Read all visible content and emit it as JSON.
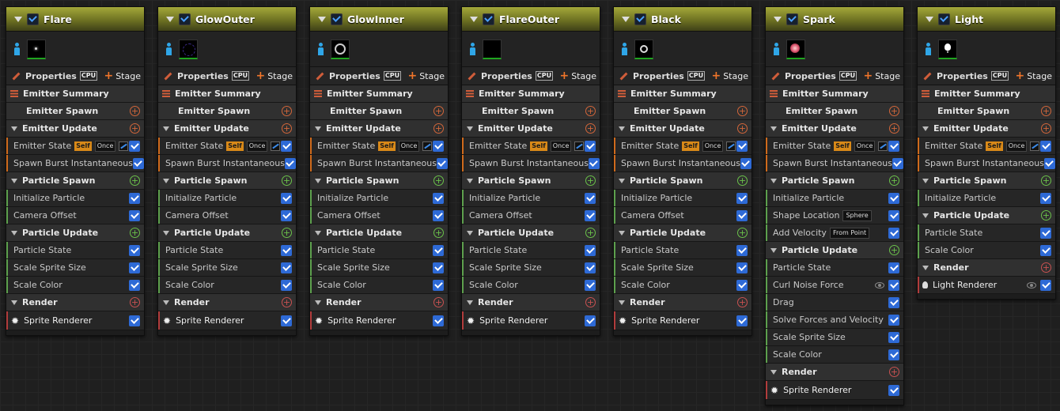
{
  "common": {
    "properties": "Properties",
    "cpu": "CPU",
    "stage": "Stage",
    "emitter_summary": "Emitter Summary",
    "emitter_spawn": "Emitter Spawn",
    "emitter_update": "Emitter Update",
    "particle_spawn": "Particle Spawn",
    "particle_update": "Particle Update",
    "render": "Render",
    "emitter_state": "Emitter State",
    "self_badge": "Self",
    "once_badge": "Once",
    "spawn_burst": "Spawn Burst Instantaneous",
    "initialize_particle": "Initialize Particle",
    "camera_offset": "Camera Offset",
    "particle_state": "Particle State",
    "scale_sprite_size": "Scale Sprite Size",
    "scale_color": "Scale Color",
    "sprite_renderer": "Sprite Renderer"
  },
  "emitters": [
    {
      "name": "Flare"
    },
    {
      "name": "GlowOuter"
    },
    {
      "name": "GlowInner"
    },
    {
      "name": "FlareOuter"
    },
    {
      "name": "Black"
    },
    {
      "name": "Spark",
      "shape_location": "Shape Location",
      "shape_location_value": "Sphere",
      "add_velocity": "Add Velocity",
      "add_velocity_value": "From Point",
      "curl_noise_force": "Curl Noise Force",
      "drag": "Drag",
      "solve_forces": "Solve Forces and Velocity"
    },
    {
      "name": "Light",
      "light_renderer": "Light Renderer"
    }
  ]
}
